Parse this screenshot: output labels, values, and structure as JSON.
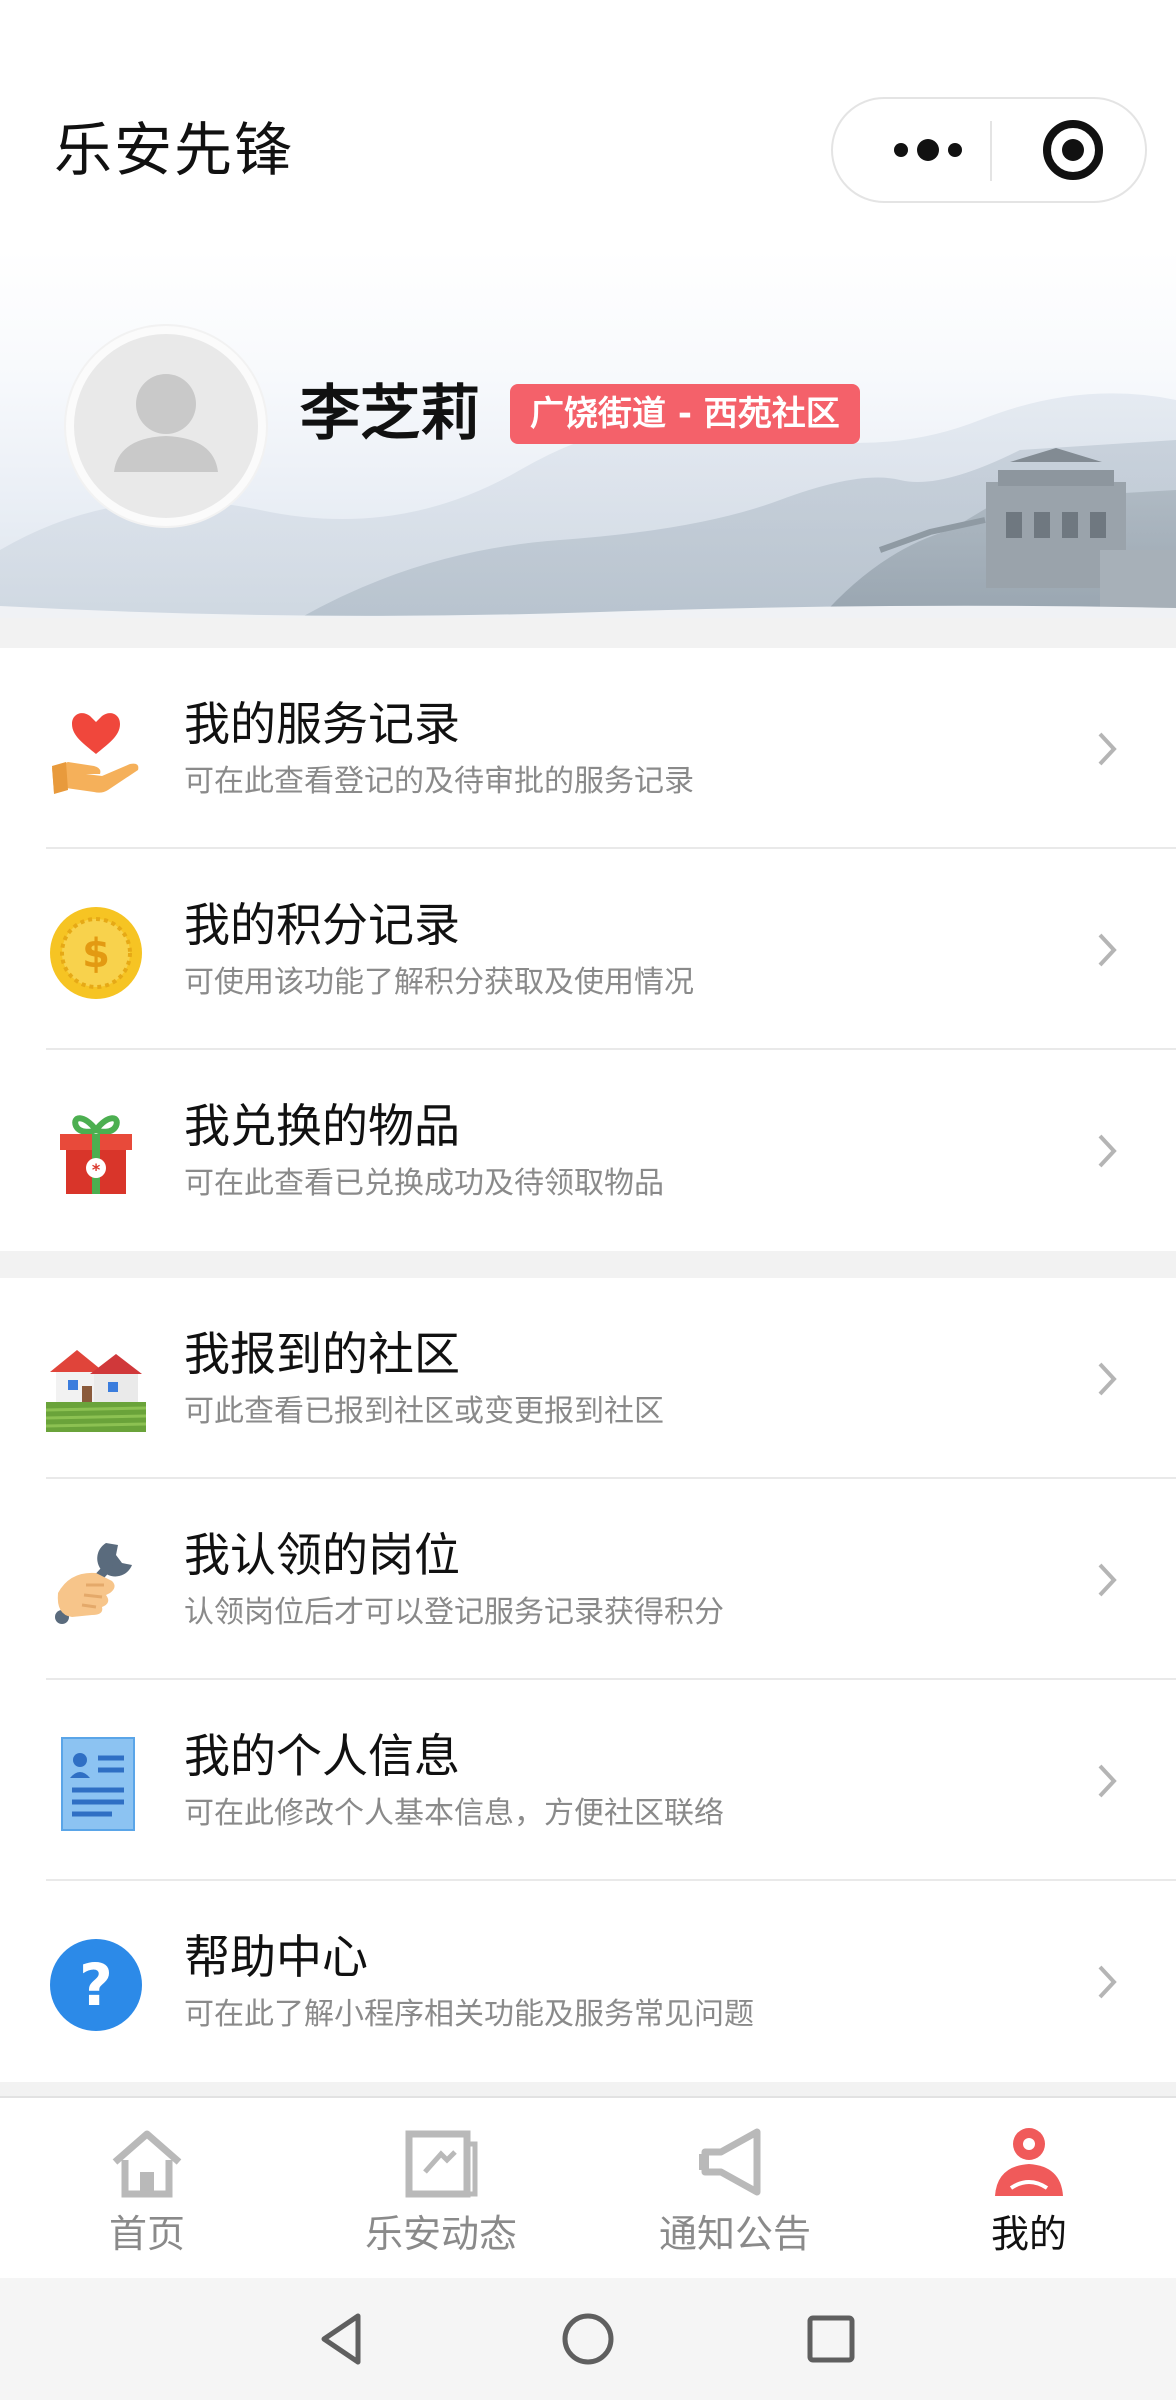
{
  "app": {
    "title": "乐安先锋"
  },
  "profile": {
    "name": "李芝莉",
    "community": "广饶街道 - 西苑社区"
  },
  "menu_groups": [
    {
      "items": [
        {
          "title": "我的服务记录",
          "subtitle": "可在此查看登记的及待审批的服务记录",
          "icon": "heart-hand-icon"
        },
        {
          "title": "我的积分记录",
          "subtitle": "可使用该功能了解积分获取及使用情况",
          "icon": "coin-icon"
        },
        {
          "title": "我兑换的物品",
          "subtitle": "可在此查看已兑换成功及待领取物品",
          "icon": "gift-icon"
        }
      ]
    },
    {
      "items": [
        {
          "title": "我报到的社区",
          "subtitle": "可此查看已报到社区或变更报到社区",
          "icon": "community-house-icon"
        },
        {
          "title": "我认领的岗位",
          "subtitle": "认领岗位后才可以登记服务记录获得积分",
          "icon": "hand-wrench-icon"
        },
        {
          "title": "我的个人信息",
          "subtitle": "可在此修改个人基本信息，方便社区联络",
          "icon": "id-card-icon"
        },
        {
          "title": "帮助中心",
          "subtitle": "可在此了解小程序相关功能及服务常见问题",
          "icon": "question-icon"
        }
      ]
    }
  ],
  "tabbar": {
    "active": 3,
    "tabs": [
      {
        "label": "首页",
        "icon": "home-icon"
      },
      {
        "label": "乐安动态",
        "icon": "news-icon"
      },
      {
        "label": "通知公告",
        "icon": "megaphone-icon"
      },
      {
        "label": "我的",
        "icon": "user-icon"
      }
    ]
  },
  "colors": {
    "badge": "#f4616a",
    "tab_active": "#f05a5a",
    "tab_inactive": "#b9b9b9"
  }
}
